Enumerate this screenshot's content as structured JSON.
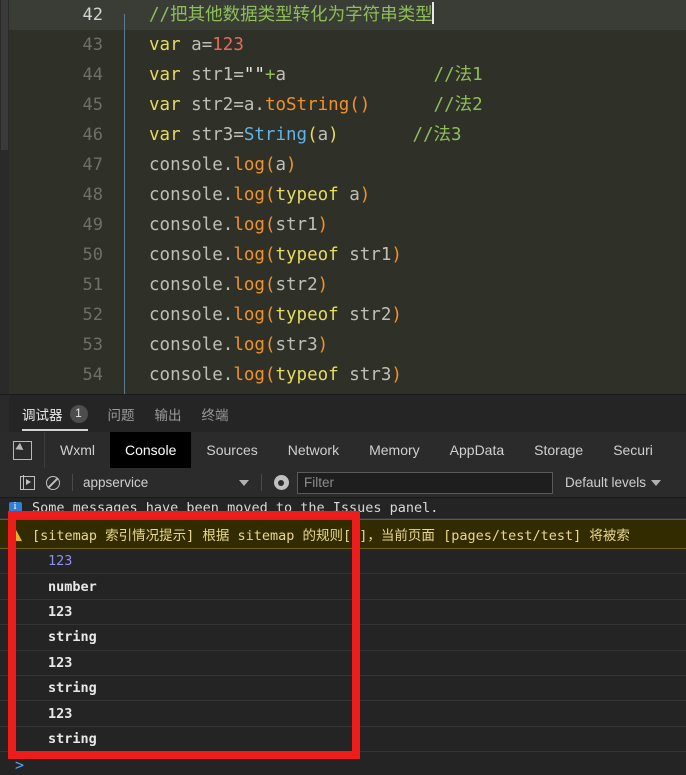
{
  "editor": {
    "lines": [
      {
        "num": "42",
        "active": true,
        "tokens": [
          {
            "t": "//把其他数据类型转化为字符串类型",
            "c": "tok-cm"
          }
        ],
        "caret": true
      },
      {
        "num": "43",
        "active": false,
        "tokens": [
          {
            "t": "var ",
            "c": "tok-kw"
          },
          {
            "t": "a",
            "c": "tok-id"
          },
          {
            "t": "=",
            "c": "tok-op"
          },
          {
            "t": "123",
            "c": "tok-num"
          }
        ]
      },
      {
        "num": "44",
        "active": false,
        "tokens": [
          {
            "t": "var ",
            "c": "tok-kw"
          },
          {
            "t": "str1",
            "c": "tok-id"
          },
          {
            "t": "=",
            "c": "tok-op"
          },
          {
            "t": "\"\"",
            "c": "tok-str"
          },
          {
            "t": "+",
            "c": "tok-cm"
          },
          {
            "t": "a",
            "c": "tok-id"
          },
          {
            "t": "              ",
            "c": "tok-op"
          },
          {
            "t": "//法1",
            "c": "tok-cm"
          }
        ]
      },
      {
        "num": "45",
        "active": false,
        "tokens": [
          {
            "t": "var ",
            "c": "tok-kw"
          },
          {
            "t": "str2",
            "c": "tok-id"
          },
          {
            "t": "=",
            "c": "tok-op"
          },
          {
            "t": "a",
            "c": "tok-id"
          },
          {
            "t": ".",
            "c": "tok-op"
          },
          {
            "t": "toString",
            "c": "tok-fn"
          },
          {
            "t": "()",
            "c": "tok-pn2"
          },
          {
            "t": "      ",
            "c": "tok-op"
          },
          {
            "t": "//法2",
            "c": "tok-cm"
          }
        ]
      },
      {
        "num": "46",
        "active": false,
        "tokens": [
          {
            "t": "var ",
            "c": "tok-kw"
          },
          {
            "t": "str3",
            "c": "tok-id"
          },
          {
            "t": "=",
            "c": "tok-op"
          },
          {
            "t": "String",
            "c": "tok-cls"
          },
          {
            "t": "(",
            "c": "tok-pn"
          },
          {
            "t": "a",
            "c": "tok-id"
          },
          {
            "t": ")",
            "c": "tok-pn"
          },
          {
            "t": "       ",
            "c": "tok-op"
          },
          {
            "t": "//法3",
            "c": "tok-cm"
          }
        ]
      },
      {
        "num": "47",
        "active": false,
        "tokens": [
          {
            "t": "console",
            "c": "tok-id"
          },
          {
            "t": ".",
            "c": "tok-op"
          },
          {
            "t": "log",
            "c": "tok-fn"
          },
          {
            "t": "(",
            "c": "tok-pn2"
          },
          {
            "t": "a",
            "c": "tok-id"
          },
          {
            "t": ")",
            "c": "tok-pn2"
          }
        ]
      },
      {
        "num": "48",
        "active": false,
        "tokens": [
          {
            "t": "console",
            "c": "tok-id"
          },
          {
            "t": ".",
            "c": "tok-op"
          },
          {
            "t": "log",
            "c": "tok-fn"
          },
          {
            "t": "(",
            "c": "tok-pn2"
          },
          {
            "t": "typeof",
            "c": "tok-kw"
          },
          {
            "t": " a",
            "c": "tok-id"
          },
          {
            "t": ")",
            "c": "tok-pn2"
          }
        ]
      },
      {
        "num": "49",
        "active": false,
        "tokens": [
          {
            "t": "console",
            "c": "tok-id"
          },
          {
            "t": ".",
            "c": "tok-op"
          },
          {
            "t": "log",
            "c": "tok-fn"
          },
          {
            "t": "(",
            "c": "tok-pn2"
          },
          {
            "t": "str1",
            "c": "tok-id"
          },
          {
            "t": ")",
            "c": "tok-pn2"
          }
        ]
      },
      {
        "num": "50",
        "active": false,
        "tokens": [
          {
            "t": "console",
            "c": "tok-id"
          },
          {
            "t": ".",
            "c": "tok-op"
          },
          {
            "t": "log",
            "c": "tok-fn"
          },
          {
            "t": "(",
            "c": "tok-pn2"
          },
          {
            "t": "typeof",
            "c": "tok-kw"
          },
          {
            "t": " str1",
            "c": "tok-id"
          },
          {
            "t": ")",
            "c": "tok-pn2"
          }
        ]
      },
      {
        "num": "51",
        "active": false,
        "tokens": [
          {
            "t": "console",
            "c": "tok-id"
          },
          {
            "t": ".",
            "c": "tok-op"
          },
          {
            "t": "log",
            "c": "tok-fn"
          },
          {
            "t": "(",
            "c": "tok-pn2"
          },
          {
            "t": "str2",
            "c": "tok-id"
          },
          {
            "t": ")",
            "c": "tok-pn2"
          }
        ]
      },
      {
        "num": "52",
        "active": false,
        "tokens": [
          {
            "t": "console",
            "c": "tok-id"
          },
          {
            "t": ".",
            "c": "tok-op"
          },
          {
            "t": "log",
            "c": "tok-fn"
          },
          {
            "t": "(",
            "c": "tok-pn2"
          },
          {
            "t": "typeof",
            "c": "tok-kw"
          },
          {
            "t": " str2",
            "c": "tok-id"
          },
          {
            "t": ")",
            "c": "tok-pn2"
          }
        ]
      },
      {
        "num": "53",
        "active": false,
        "tokens": [
          {
            "t": "console",
            "c": "tok-id"
          },
          {
            "t": ".",
            "c": "tok-op"
          },
          {
            "t": "log",
            "c": "tok-fn"
          },
          {
            "t": "(",
            "c": "tok-pn2"
          },
          {
            "t": "str3",
            "c": "tok-id"
          },
          {
            "t": ")",
            "c": "tok-pn2"
          }
        ]
      },
      {
        "num": "54",
        "active": false,
        "tokens": [
          {
            "t": "console",
            "c": "tok-id"
          },
          {
            "t": ".",
            "c": "tok-op"
          },
          {
            "t": "log",
            "c": "tok-fn"
          },
          {
            "t": "(",
            "c": "tok-pn2"
          },
          {
            "t": "typeof",
            "c": "tok-kw"
          },
          {
            "t": " str3",
            "c": "tok-id"
          },
          {
            "t": ")",
            "c": "tok-pn2"
          }
        ]
      }
    ]
  },
  "panel_tabs": [
    {
      "label": "调试器",
      "count": "1",
      "active": true
    },
    {
      "label": "问题",
      "count": null,
      "active": false
    },
    {
      "label": "输出",
      "count": null,
      "active": false
    },
    {
      "label": "终端",
      "count": null,
      "active": false
    }
  ],
  "devtools_tabs": [
    {
      "label": "Wxml",
      "active": false
    },
    {
      "label": "Console",
      "active": true
    },
    {
      "label": "Sources",
      "active": false
    },
    {
      "label": "Network",
      "active": false
    },
    {
      "label": "Memory",
      "active": false
    },
    {
      "label": "AppData",
      "active": false
    },
    {
      "label": "Storage",
      "active": false
    },
    {
      "label": "Securi",
      "active": false
    }
  ],
  "console_toolbar": {
    "context_value": "appservice",
    "filter_placeholder": "Filter",
    "filter_value": "",
    "levels_label": "Default levels"
  },
  "console_rows": [
    {
      "kind": "info",
      "text": "Some messages have been moved to the Issues panel."
    },
    {
      "kind": "warn",
      "text": "[sitemap 索引情况提示] 根据 sitemap 的规则[0]，当前页面 [pages/test/test] 将被索"
    },
    {
      "kind": "log",
      "type": "number",
      "text": "123"
    },
    {
      "kind": "log",
      "type": "string",
      "text": "number"
    },
    {
      "kind": "log",
      "type": "string",
      "text": "123"
    },
    {
      "kind": "log",
      "type": "string",
      "text": "string"
    },
    {
      "kind": "log",
      "type": "string",
      "text": "123"
    },
    {
      "kind": "log",
      "type": "string",
      "text": "string"
    },
    {
      "kind": "log",
      "type": "string",
      "text": "123"
    },
    {
      "kind": "log",
      "type": "string",
      "text": "string"
    }
  ],
  "console_prompt": {
    "chevron": ">"
  },
  "colors": {
    "annotation_red": "#ef1c1c",
    "editor_bg": "#2f3129",
    "console_bg": "#242424",
    "warn_bg": "#332b00",
    "accent_blue": "#5a9cf8"
  }
}
